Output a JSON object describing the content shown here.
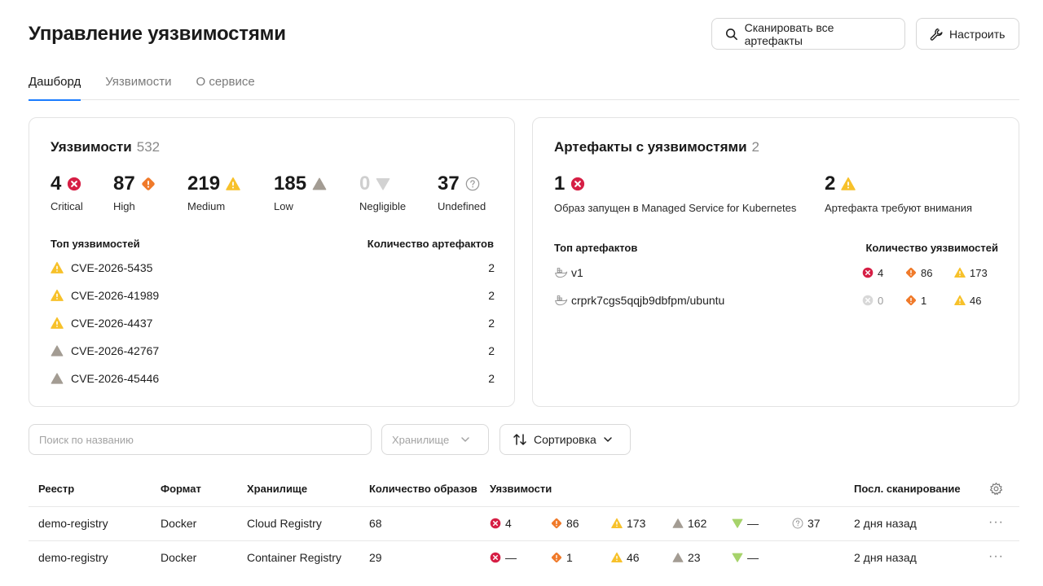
{
  "header": {
    "title": "Управление уязвимостями",
    "scan_all_label": "Сканировать все артефакты",
    "configure_label": "Настроить"
  },
  "tabs": [
    {
      "label": "Дашборд",
      "active": true
    },
    {
      "label": "Уязвимости",
      "active": false
    },
    {
      "label": "О сервисе",
      "active": false
    }
  ],
  "vuln_card": {
    "title": "Уязвимости",
    "total": "532",
    "stats": [
      {
        "value": "4",
        "label": "Critical",
        "icon": "critical-icon"
      },
      {
        "value": "87",
        "label": "High",
        "icon": "high-icon"
      },
      {
        "value": "219",
        "label": "Medium",
        "icon": "medium-icon"
      },
      {
        "value": "185",
        "label": "Low",
        "icon": "low-icon"
      },
      {
        "value": "0",
        "label": "Negligible",
        "icon": "negligible-icon"
      },
      {
        "value": "37",
        "label": "Undefined",
        "icon": "undefined-icon"
      }
    ],
    "top_header": "Топ уязвимостей",
    "count_header": "Количество артефактов",
    "top": [
      {
        "id": "CVE-2026-5435",
        "severity": "medium",
        "count": "2"
      },
      {
        "id": "CVE-2026-41989",
        "severity": "medium",
        "count": "2"
      },
      {
        "id": "CVE-2026-4437",
        "severity": "medium",
        "count": "2"
      },
      {
        "id": "CVE-2026-42767",
        "severity": "low",
        "count": "2"
      },
      {
        "id": "CVE-2026-45446",
        "severity": "low",
        "count": "2"
      }
    ]
  },
  "artifacts_card": {
    "title": "Артефакты с уязвимостями",
    "total": "2",
    "stats": [
      {
        "value": "1",
        "label": "Образ запущен в Managed Service for Kubernetes",
        "icon": "critical-icon"
      },
      {
        "value": "2",
        "label": "Артефакта требуют внимания",
        "icon": "medium-icon"
      }
    ],
    "top_header": "Топ артефактов",
    "count_header": "Количество уязвимостей",
    "top": [
      {
        "name": "v1",
        "critical": "4",
        "critical_dim": false,
        "high": "86",
        "medium": "173"
      },
      {
        "name": "crprk7cgs5qqjb9dbfpm/ubuntu",
        "critical": "0",
        "critical_dim": true,
        "high": "1",
        "medium": "46"
      }
    ]
  },
  "filters": {
    "search_placeholder": "Поиск по названию",
    "storage_placeholder": "Хранилище",
    "sort_label": "Сортировка"
  },
  "table": {
    "headers": {
      "registry": "Реестр",
      "format": "Формат",
      "storage": "Хранилище",
      "images": "Количество образов",
      "vulns": "Уязвимости",
      "last_scan": "Посл. сканирование"
    },
    "rows": [
      {
        "registry": "demo-registry",
        "format": "Docker",
        "storage": "Cloud Registry",
        "images": "68",
        "critical": "4",
        "high": "86",
        "medium": "173",
        "low": "162",
        "negligible": "—",
        "undefined": "37",
        "last_scan": "2 дня назад"
      },
      {
        "registry": "demo-registry",
        "format": "Docker",
        "storage": "Container Registry",
        "images": "29",
        "critical": "—",
        "high": "1",
        "medium": "46",
        "low": "23",
        "negligible": "—",
        "undefined": "",
        "last_scan": "2 дня назад"
      }
    ]
  },
  "colors": {
    "critical": "#d61f45",
    "high": "#f07a2a",
    "medium": "#f7c12a",
    "low": "#a39c93",
    "negligible_dim": "#d2d2d2",
    "negligible_table": "#a6d36b",
    "accent": "#1a7cff"
  }
}
